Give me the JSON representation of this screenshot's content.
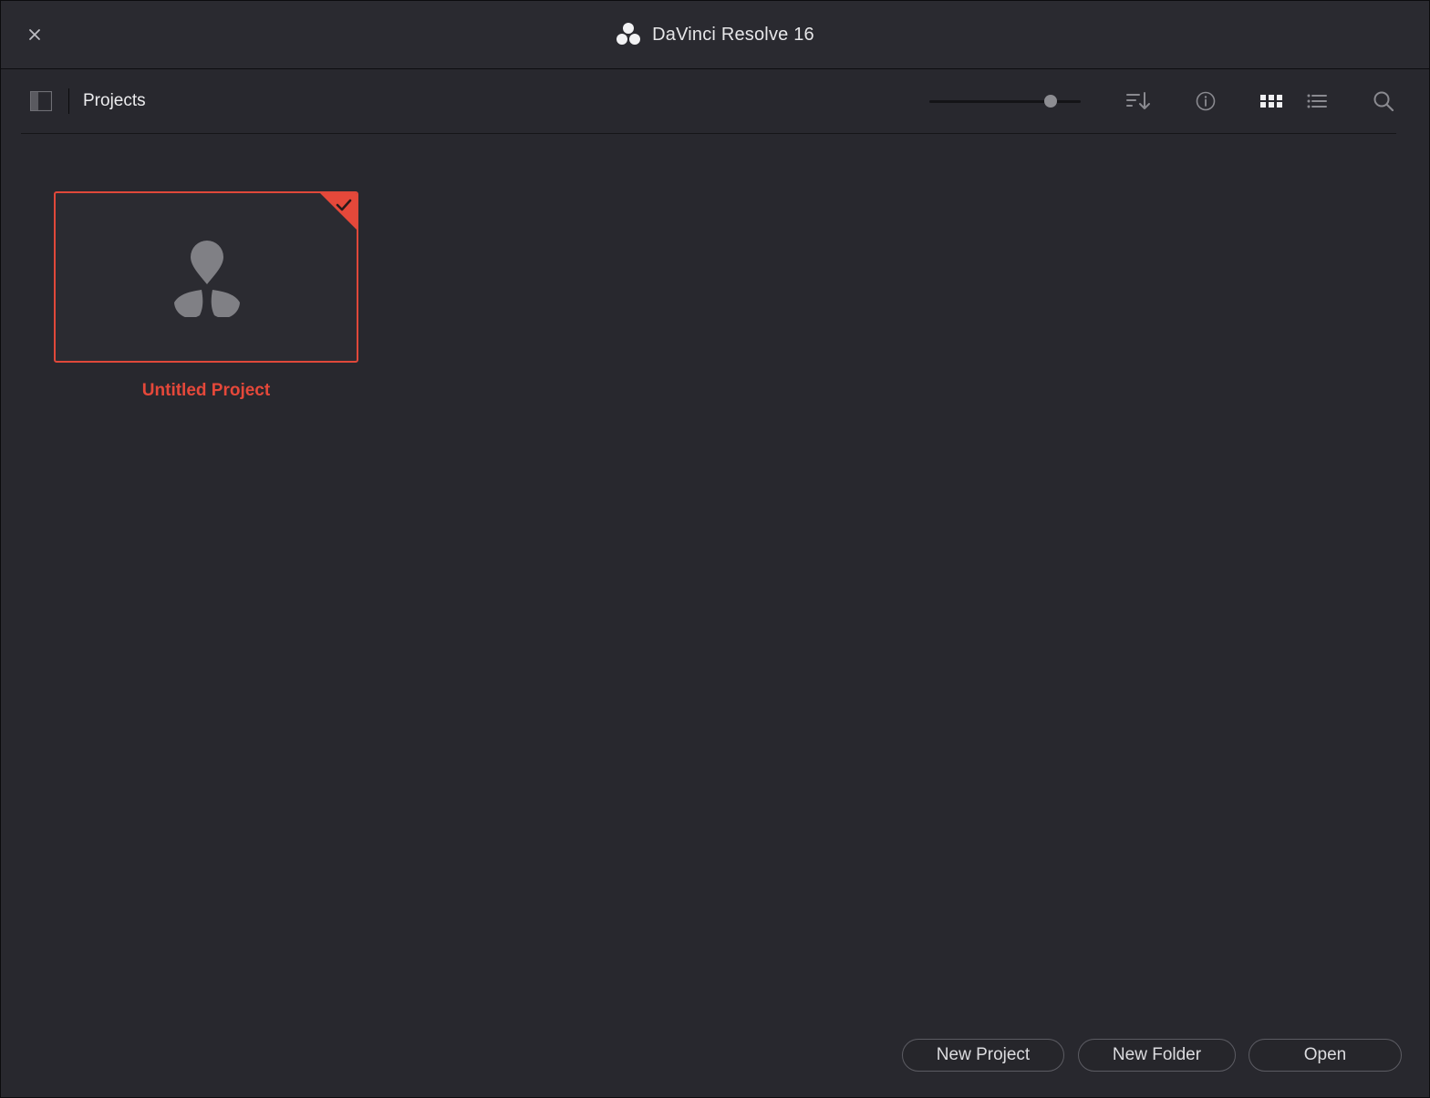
{
  "window": {
    "title": "DaVinci Resolve 16",
    "close_icon": "close-icon",
    "logo_icon": "davinci-logo-icon"
  },
  "toolbar": {
    "title": "Projects",
    "sidebar_toggle_icon": "sidebar-panel-icon",
    "zoom_level": 0.8,
    "icons": [
      "sort-icon",
      "info-icon",
      "grid-view-icon",
      "list-view-icon",
      "search-icon"
    ],
    "active_view": "grid"
  },
  "projects": [
    {
      "name": "Untitled Project",
      "selected": true,
      "thumbnail_icon": "davinci-logo-icon",
      "badge_icon": "checkmark-icon"
    }
  ],
  "footer": {
    "new_project_label": "New Project",
    "new_folder_label": "New Folder",
    "open_label": "Open"
  },
  "colors": {
    "background": "#28282e",
    "accent": "#e5483a",
    "text": "#e6e6e8"
  }
}
